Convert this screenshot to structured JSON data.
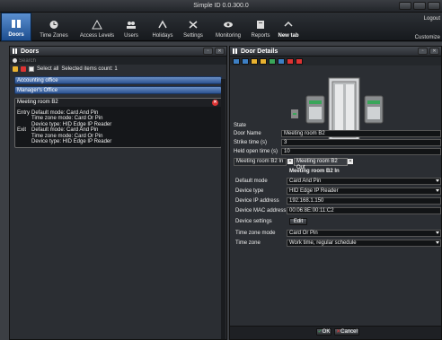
{
  "window": {
    "title": "Simple ID 0.0.300.0"
  },
  "ribbon": {
    "tabs": [
      {
        "label": "Doors",
        "icon": "door-icon"
      },
      {
        "label": "Time Zones",
        "icon": "clock-icon"
      },
      {
        "label": "Access Levels",
        "icon": "access-icon"
      },
      {
        "label": "Users",
        "icon": "users-icon"
      },
      {
        "label": "Holidays",
        "icon": "holidays-icon"
      },
      {
        "label": "Settings",
        "icon": "settings-icon"
      },
      {
        "label": "Monitoring",
        "icon": "monitoring-icon"
      },
      {
        "label": "Reports",
        "icon": "reports-icon"
      },
      {
        "label": "New tab",
        "icon": "newtab-icon"
      }
    ],
    "logout": "Logout",
    "customize": "Customize"
  },
  "doors_panel": {
    "title": "Doors",
    "search_placeholder": "Search",
    "select_all": "Select all",
    "selected_count_text": "Selected items count: 1",
    "items": [
      "Accounting office",
      "Manager's Office"
    ],
    "expanded": {
      "name": "Meeting room B2",
      "entry_label": "Entry",
      "exit_label": "Exit",
      "entry_lines": [
        "Default mode: Card And Pin",
        "Time zone mode: Card Or Pin",
        "Device type: HID Edge IP Reader"
      ],
      "exit_lines": [
        "Default mode: Card And Pin",
        "Time zone mode: Card Or Pin",
        "Device type: HID Edge IP Reader"
      ]
    }
  },
  "details_panel": {
    "title": "Door Details",
    "state_label": "State",
    "door_name_label": "Door Name",
    "door_name_value": "Meeting room B2",
    "strike_time_label": "Strike time (s)",
    "strike_time_value": "3",
    "held_open_label": "Held open time (s)",
    "held_open_value": "10",
    "reader_tabs": [
      "Meeting room B2 In",
      "Meeting room B2 Out"
    ],
    "reader_header": "Meeting room B2 In",
    "default_mode_label": "Default mode",
    "default_mode_value": "Card And Pin",
    "device_type_label": "Device type",
    "device_type_value": "HID Edge IP Reader",
    "ip_label": "Device IP address",
    "ip_value": "192.168.1.150",
    "mac_label": "Device MAC address",
    "mac_value": "00:06:8E:00:11:C2",
    "device_settings_label": "Device settings",
    "edit_label": "Edit",
    "tz_mode_label": "Time zone mode",
    "tz_mode_value": "Card Or Pin",
    "timezone_label": "Time zone",
    "timezone_value": "Work time, regular schedule",
    "ok_label": "OK",
    "cancel_label": "Cancel"
  }
}
